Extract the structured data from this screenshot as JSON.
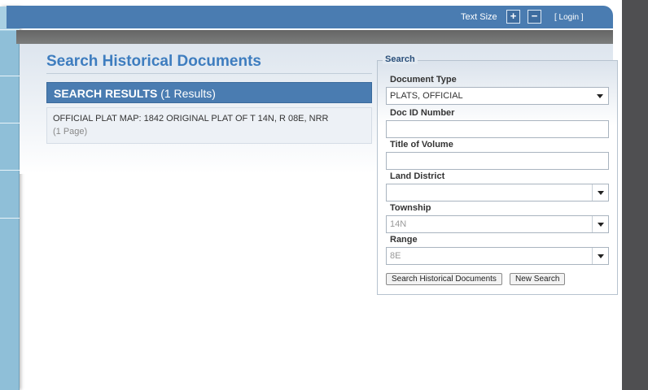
{
  "header": {
    "text_size_label": "Text Size",
    "increase_symbol": "+",
    "decrease_symbol": "−",
    "login_label": "[ Login ]"
  },
  "main": {
    "title": "Search Historical Documents",
    "results_label": "SEARCH RESULTS",
    "results_count": "(1 Results)",
    "results": [
      {
        "title": "OFFICIAL PLAT MAP: 1842 ORIGINAL PLAT OF T 14N, R 08E, NRR",
        "pages": "(1 Page)"
      }
    ]
  },
  "search": {
    "legend": "Search",
    "document_type": {
      "label": "Document Type",
      "value": "PLATS, OFFICIAL"
    },
    "doc_id": {
      "label": "Doc ID Number",
      "value": ""
    },
    "title_of_volume": {
      "label": "Title of Volume",
      "value": ""
    },
    "land_district": {
      "label": "Land District",
      "value": ""
    },
    "township": {
      "label": "Township",
      "value": "14N"
    },
    "range": {
      "label": "Range",
      "value": "8E"
    },
    "search_button": "Search Historical Documents",
    "new_search_button": "New Search"
  },
  "colors": {
    "header_blue": "#4a7cb1",
    "title_blue": "#3e7dbf",
    "sidebar_blue": "#8fbfd8",
    "gutter_gray": "#4f4f51"
  }
}
